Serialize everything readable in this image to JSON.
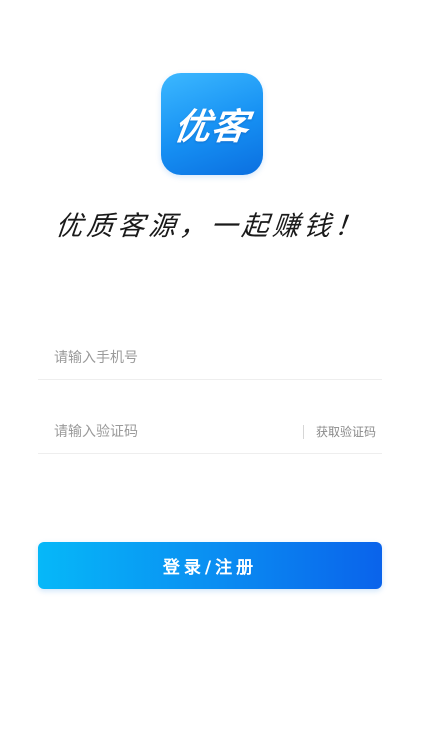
{
  "app": {
    "logo_text": "优客",
    "slogan": "优质客源，一起赚钱！"
  },
  "form": {
    "phone_placeholder": "请输入手机号",
    "phone_value": "",
    "code_placeholder": "请输入验证码",
    "code_value": "",
    "get_code_label": "获取验证码",
    "submit_label": "登录/注册"
  },
  "colors": {
    "brand_blue": "#1690f3",
    "button_gradient_start": "#06b8f8",
    "button_gradient_end": "#0a63eb",
    "placeholder_gray": "#9a9a9a",
    "divider_gray": "#eeeeee"
  }
}
